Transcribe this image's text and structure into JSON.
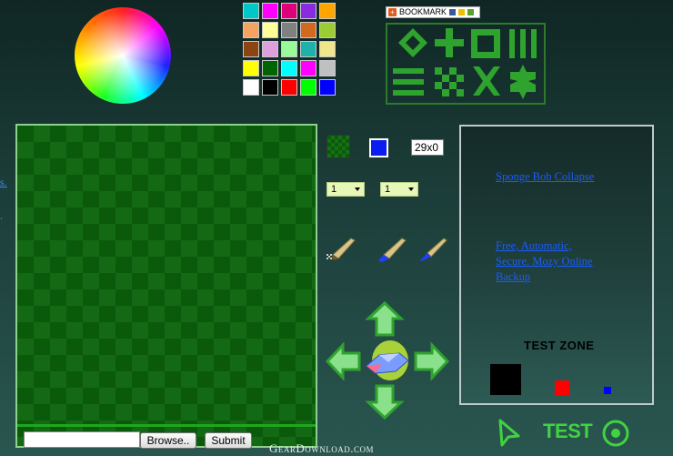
{
  "palette": {
    "colors": [
      "#00c8c8",
      "#ff00ff",
      "#e0007a",
      "#8a2be2",
      "#ffa500",
      "#f4a460",
      "#ffff99",
      "#808080",
      "#d2691e",
      "#9acd32",
      "#8b4513",
      "#dda0dd",
      "#98fb98",
      "#20b2aa",
      "#f0e68c",
      "#ffff00",
      "#006400",
      "#00ffff",
      "#ff00ff",
      "#c0c0c0",
      "#ffffff",
      "#000000",
      "#ff0000",
      "#00ff00",
      "#0000ff"
    ]
  },
  "bookmark": {
    "label": "BOOKMARK"
  },
  "toolbar": {
    "brush_size": "29x0",
    "dropdown1_value": "1",
    "dropdown2_value": "1",
    "selected_color": "#0a1cf0"
  },
  "upload": {
    "browse_label": "Browse..",
    "submit_label": "Submit"
  },
  "watermark": "GearDownload.com",
  "edge": {
    "link_fragment": "s."
  },
  "right_panel": {
    "ad1": "Sponge Bob Collapse",
    "ad2": "Free, Automatic, Secure. Mozy Online Backup",
    "testzone_title": "TEST ZONE",
    "samples": [
      "#000000",
      "#ff0000",
      "#0000ff"
    ]
  },
  "footer": {
    "test_label": "TEST"
  }
}
